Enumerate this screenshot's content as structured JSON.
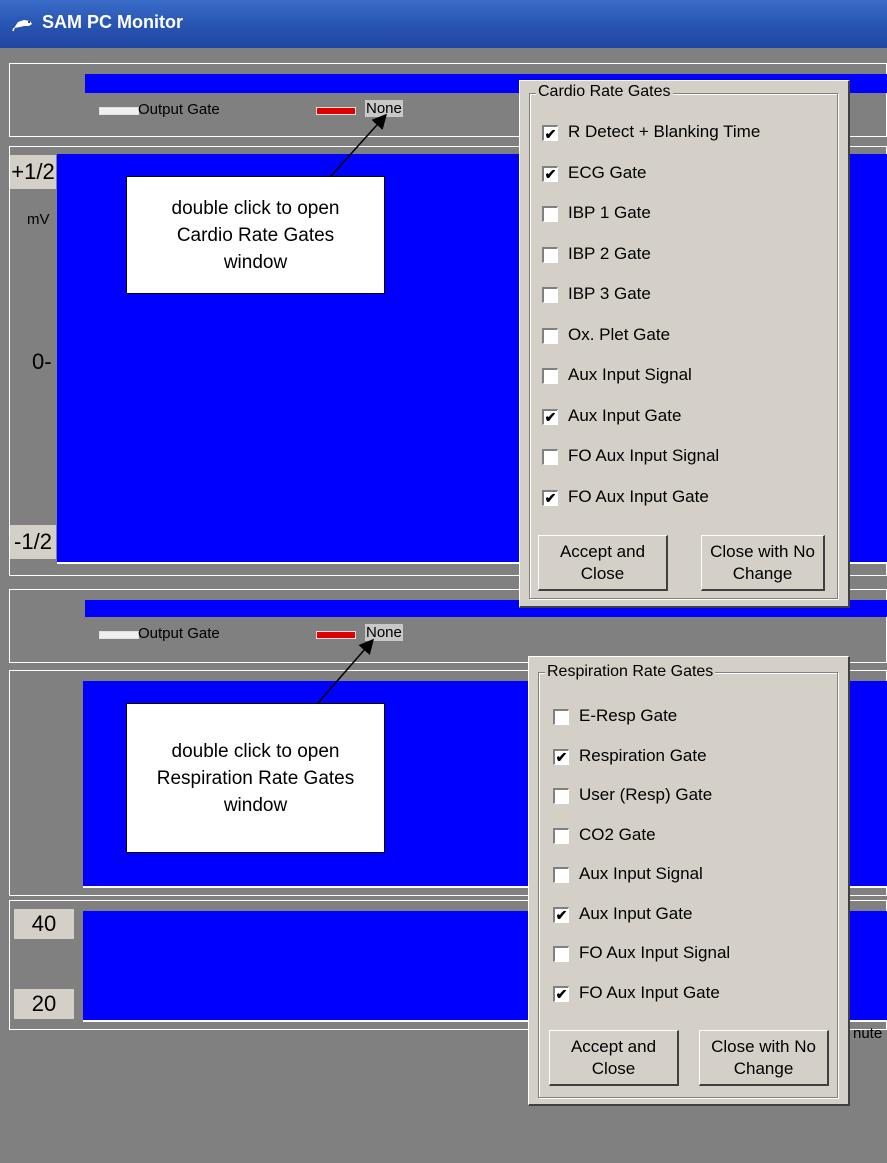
{
  "window": {
    "title": "SAM PC Monitor"
  },
  "cardio_panel": {
    "legend_output_gate": "Output Gate",
    "legend_none": "None",
    "y_top": "+1/2",
    "y_unit": "mV",
    "y_mid": "0-",
    "y_bottom": "-1/2",
    "callout": "double click to open Cardio Rate Gates window"
  },
  "resp_panel": {
    "legend_output_gate": "Output Gate",
    "legend_none": "None",
    "callout": "double click to open Respiration Rate Gates window"
  },
  "rate_panel": {
    "y_top": "40",
    "y_bottom": "20",
    "cut_label": "nute"
  },
  "cardio_dialog": {
    "title": "Cardio Rate Gates",
    "items": [
      {
        "label": "R Detect + Blanking Time",
        "checked": true
      },
      {
        "label": "ECG Gate",
        "checked": true
      },
      {
        "label": "IBP 1 Gate",
        "checked": false
      },
      {
        "label": "IBP 2 Gate",
        "checked": false
      },
      {
        "label": "IBP 3 Gate",
        "checked": false
      },
      {
        "label": "Ox. Plet Gate",
        "checked": false
      },
      {
        "label": "Aux Input Signal",
        "checked": false
      },
      {
        "label": "Aux Input Gate",
        "checked": true
      },
      {
        "label": "FO Aux Input Signal",
        "checked": false
      },
      {
        "label": "FO Aux Input Gate",
        "checked": true
      }
    ],
    "accept_label": "Accept and Close",
    "close_label": "Close with No Change"
  },
  "resp_dialog": {
    "title": "Respiration Rate Gates",
    "items": [
      {
        "label": "E-Resp Gate",
        "checked": false
      },
      {
        "label": "Respiration Gate",
        "checked": true
      },
      {
        "label": "User (Resp) Gate",
        "checked": false
      },
      {
        "label": "CO2 Gate",
        "checked": false
      },
      {
        "label": "Aux Input Signal",
        "checked": false
      },
      {
        "label": "Aux Input Gate",
        "checked": true
      },
      {
        "label": "FO Aux Input Signal",
        "checked": false
      },
      {
        "label": "FO Aux Input Gate",
        "checked": true
      }
    ],
    "accept_label": "Accept and Close",
    "close_label": "Close with No Change"
  },
  "colors": {
    "plot_blue": "#0000ff",
    "background": "#808080",
    "dialog_face": "#d4d0c8",
    "title_blue": "#2a57b5",
    "gate_red": "#e00000"
  },
  "icons": {
    "app": "rat-icon",
    "check": "checkmark-icon"
  }
}
